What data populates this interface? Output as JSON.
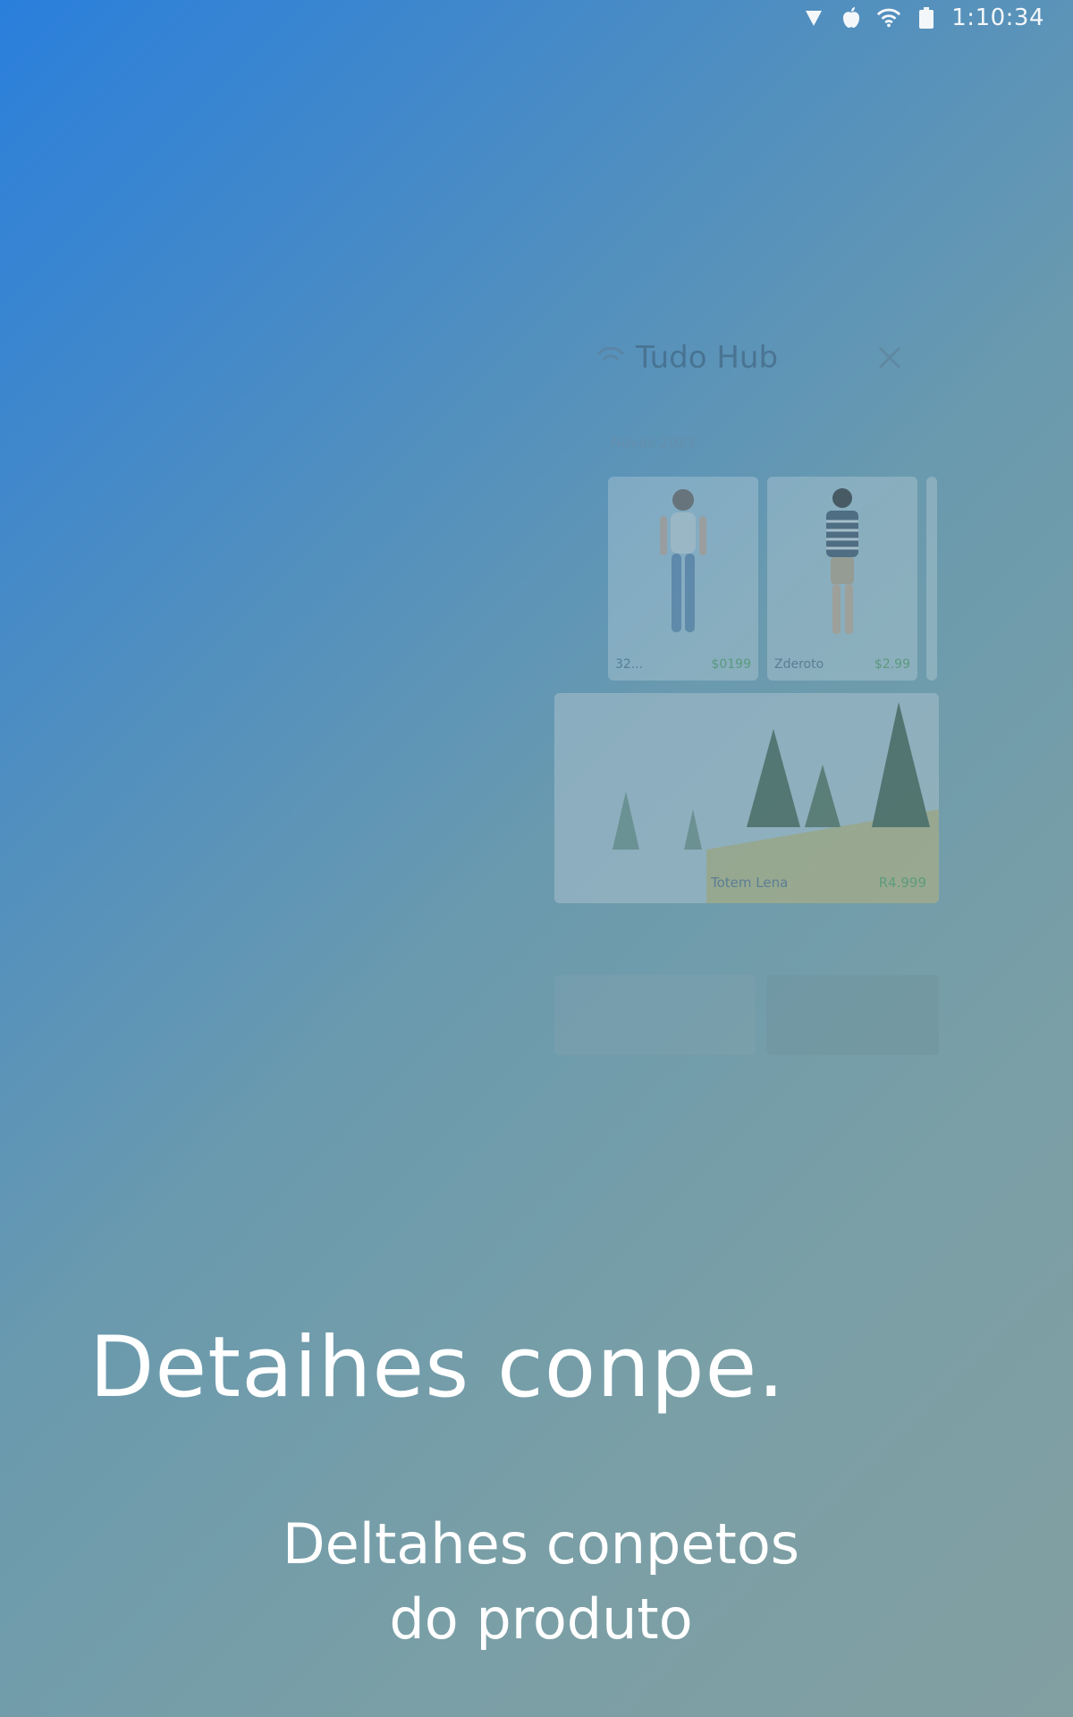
{
  "status_bar": {
    "time": "1:10:34",
    "icons": [
      "signal-icon",
      "apple-icon",
      "wifi-icon",
      "battery-icon"
    ]
  },
  "panel": {
    "title": "Tudo Hub",
    "section_label": "Novas 2023",
    "cards": [
      {
        "name": "32...",
        "price": "$0199"
      },
      {
        "name": "Zderoto",
        "price": "$2.99"
      }
    ],
    "wide_card": {
      "name": "Totem Lena",
      "price": "R4.999"
    }
  },
  "overlay": {
    "headline": "Detaihes conpe.",
    "subtitle_line1": "Deltahes conpetos",
    "subtitle_line2": "do produto"
  },
  "colors": {
    "gradient_start": "#2a7fdc",
    "gradient_end": "#829fa2",
    "text": "#ffffff",
    "price": "#4c9a5a"
  }
}
